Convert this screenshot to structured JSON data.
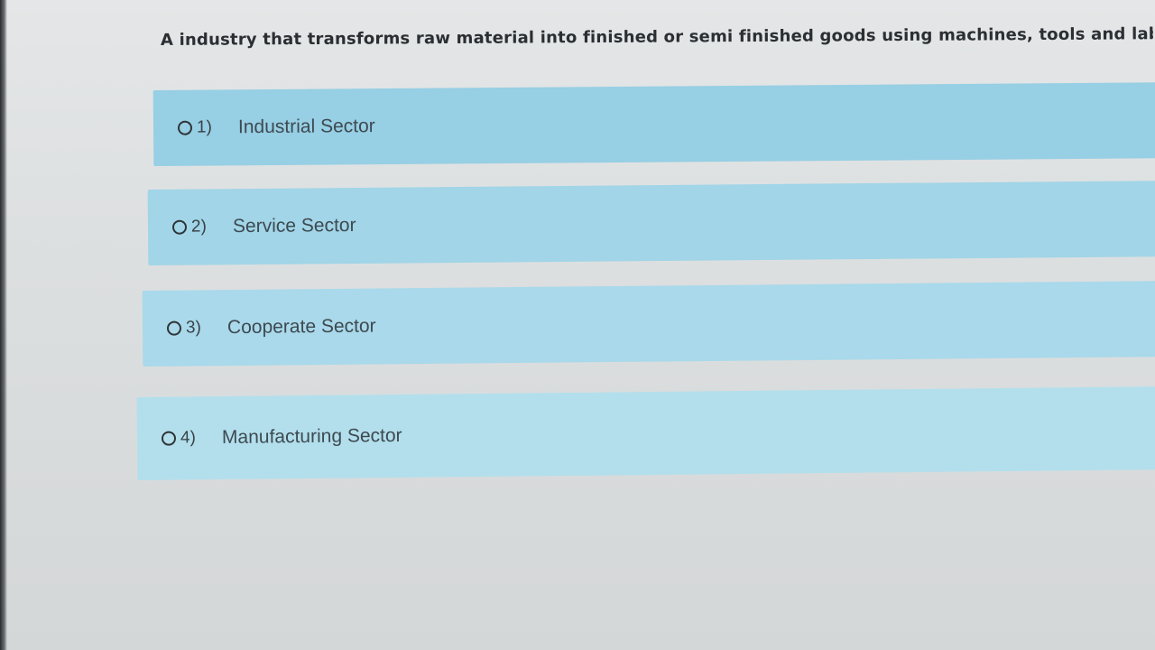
{
  "question": {
    "text": "A industry that transforms raw material into finished or semi finished goods using machines, tools and labo"
  },
  "options": [
    {
      "number": "1)",
      "label": "Industrial Sector"
    },
    {
      "number": "2)",
      "label": "Service Sector"
    },
    {
      "number": "3)",
      "label": "Cooperate Sector"
    },
    {
      "number": "4)",
      "label": "Manufacturing Sector"
    }
  ],
  "colors": {
    "option_background": "#9fd3e6",
    "page_background": "#dcdfe0",
    "question_text": "#2b2f33"
  },
  "icons": {
    "radio": "radio-unselected-icon"
  }
}
